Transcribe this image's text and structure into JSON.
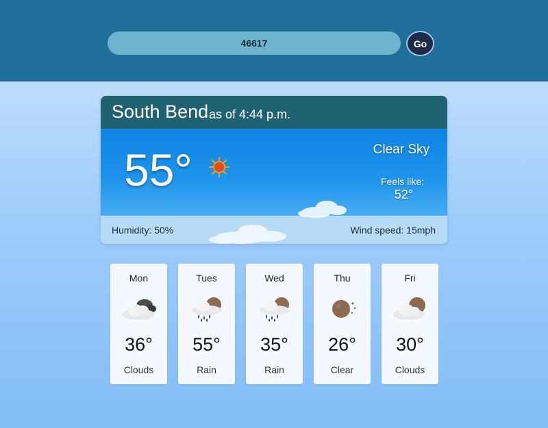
{
  "search": {
    "value": "46617",
    "go_label": "Go"
  },
  "current": {
    "city": "South Bend",
    "as_of": "as of 4:44 p.m.",
    "temperature": "55°",
    "icon": "sun-icon",
    "condition": "Clear Sky",
    "feels_like_label": "Feels like:",
    "feels_like_value": "52°",
    "humidity": "Humidity: 50%",
    "wind": "Wind speed: 15mph"
  },
  "forecast": [
    {
      "day": "Mon",
      "temp": "36°",
      "condition": "Clouds",
      "icon": "clouds-icon"
    },
    {
      "day": "Tues",
      "temp": "55°",
      "condition": "Rain",
      "icon": "rain-icon"
    },
    {
      "day": "Wed",
      "temp": "35°",
      "condition": "Rain",
      "icon": "rain-icon"
    },
    {
      "day": "Thu",
      "temp": "26°",
      "condition": "Clear",
      "icon": "clear-night-icon"
    },
    {
      "day": "Fri",
      "temp": "30°",
      "condition": "Clouds",
      "icon": "partly-cloudy-icon"
    }
  ],
  "colors": {
    "header": "#206f9b",
    "search_bg": "#6db5cf",
    "go_bg": "#1f2a48",
    "card_header": "#1f6272",
    "card_body": "#1c93ec"
  }
}
